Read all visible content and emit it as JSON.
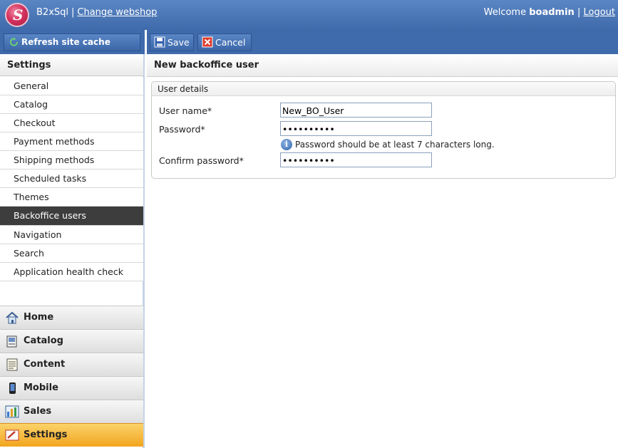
{
  "header": {
    "logo_letter": "S",
    "app_name": "B2xSql",
    "separator": "|",
    "change_webshop": "Change webshop",
    "welcome_prefix": "Welcome",
    "username": "boadmin",
    "logout": "Logout"
  },
  "sidebar": {
    "refresh_label": "Refresh site cache",
    "heading": "Settings",
    "items": [
      {
        "label": "General"
      },
      {
        "label": "Catalog"
      },
      {
        "label": "Checkout"
      },
      {
        "label": "Payment methods"
      },
      {
        "label": "Shipping methods"
      },
      {
        "label": "Scheduled tasks"
      },
      {
        "label": "Themes"
      },
      {
        "label": "Backoffice users",
        "active": true
      },
      {
        "label": "Navigation"
      },
      {
        "label": "Search"
      },
      {
        "label": "Application health check"
      }
    ],
    "sections": [
      {
        "label": "Home",
        "icon": "home-icon"
      },
      {
        "label": "Catalog",
        "icon": "catalog-icon"
      },
      {
        "label": "Content",
        "icon": "content-icon"
      },
      {
        "label": "Mobile",
        "icon": "mobile-icon"
      },
      {
        "label": "Sales",
        "icon": "sales-icon"
      },
      {
        "label": "Settings",
        "icon": "settings-icon",
        "active": true
      }
    ]
  },
  "toolbar": {
    "save_label": "Save",
    "cancel_label": "Cancel"
  },
  "page": {
    "title": "New backoffice user"
  },
  "form": {
    "legend": "User details",
    "username_label": "User name*",
    "username_value": "New_BO_User",
    "password_label": "Password*",
    "password_value": "••••••••••",
    "password_hint": "Password should be at least 7 characters long.",
    "confirm_label": "Confirm password*",
    "confirm_value": "••••••••••"
  },
  "colors": {
    "header_blue": "#3f6aab",
    "active_menu": "#3d3d3d",
    "active_section": "#f2a51f"
  }
}
